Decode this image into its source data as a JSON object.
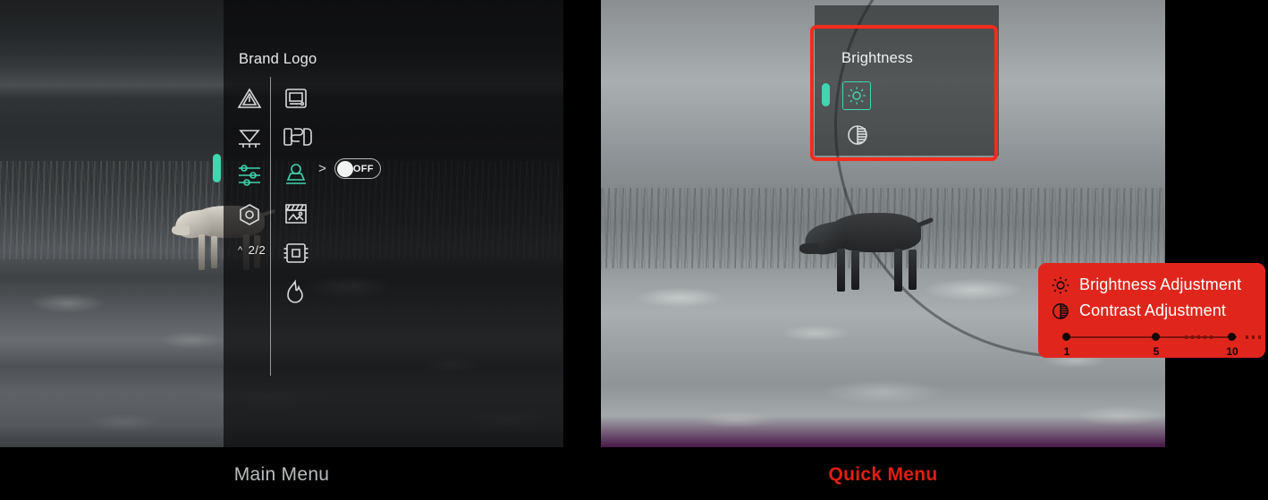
{
  "panels": {
    "main": {
      "caption": "Main Menu",
      "brand_logo": "Brand Logo",
      "page_indicator": "2/2",
      "page_chevron": "^",
      "arrow_glyph": ">",
      "toggle": {
        "label": "OFF",
        "state": "off"
      },
      "left_column_icons": [
        {
          "name": "warning-triangle-icon",
          "label": "Warning"
        },
        {
          "name": "calibration-icon",
          "label": "Calibration"
        },
        {
          "name": "sliders-icon",
          "label": "Adjustments",
          "active": true
        }
      ],
      "right_column_icons": [
        {
          "name": "display-monitor-icon",
          "label": "Display"
        },
        {
          "name": "osd-icon",
          "label": "OSD"
        },
        {
          "name": "stamp-icon",
          "label": "Watermark",
          "active": true
        },
        {
          "name": "image-gallery-icon",
          "label": "Gallery"
        },
        {
          "name": "pip-frame-icon",
          "label": "Picture in Picture"
        },
        {
          "name": "flame-icon",
          "label": "Hot Track"
        }
      ]
    },
    "quick": {
      "caption": "Quick Menu",
      "title": "Brightness",
      "icons": [
        {
          "name": "sun-brightness-icon",
          "label": "Brightness",
          "active": true
        },
        {
          "name": "contrast-icon",
          "label": "Contrast",
          "active": false
        }
      ]
    }
  },
  "callout": {
    "items": [
      {
        "icon": "sun-brightness-icon",
        "label": "Brightness Adjustment"
      },
      {
        "icon": "contrast-icon",
        "label": "Contrast Adjustment"
      }
    ],
    "slider": {
      "ticks": [
        "1",
        "5",
        "10"
      ],
      "min": 1,
      "max": 10
    }
  },
  "colors": {
    "accent_teal": "#3fd6b0",
    "callout_red": "#e0261c",
    "highlight_red": "#f42b1e",
    "icon_white": "#d9dcdc"
  }
}
